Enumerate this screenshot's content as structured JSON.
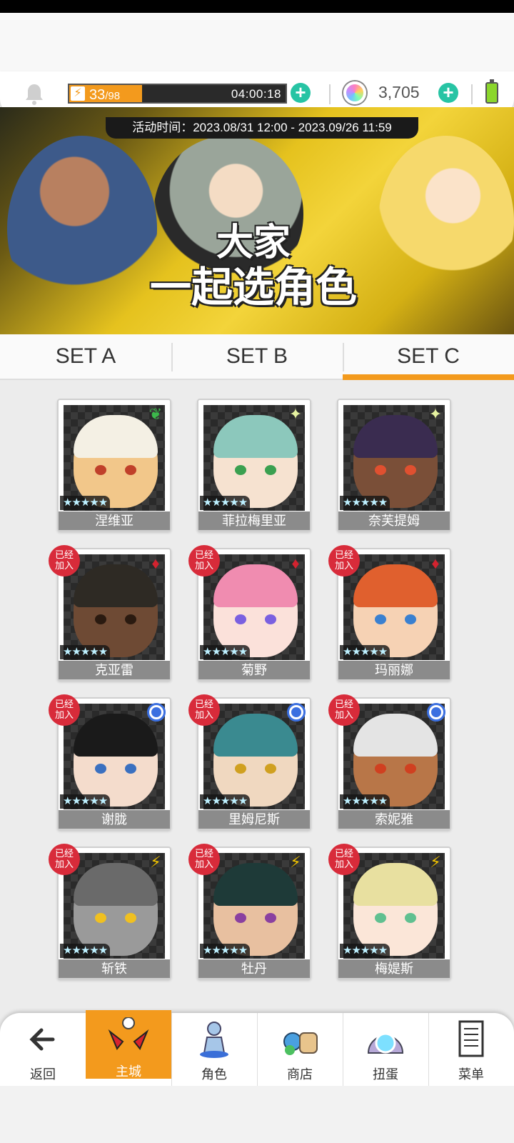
{
  "top_bar": {
    "energy_current": "33",
    "energy_max": "/98",
    "energy_fraction": 0.337,
    "energy_timer": "04:00:18",
    "gems": "3,705"
  },
  "banner": {
    "event_time": "活动时间：2023.08/31 12:00 - 2023.09/26 11:59",
    "title_line1": "大家",
    "title_line2": "一起选角色"
  },
  "tabs": [
    {
      "label": "SET A",
      "active": false
    },
    {
      "label": "SET B",
      "active": false
    },
    {
      "label": "SET C",
      "active": true
    }
  ],
  "joined_label_1": "已经",
  "joined_label_2": "加入",
  "characters": [
    {
      "name": "涅维亚",
      "element": "leaf-icon",
      "joined": false,
      "stars": 5
    },
    {
      "name": "菲拉梅里亚",
      "element": "sparkle-icon",
      "joined": false,
      "stars": 5
    },
    {
      "name": "奈芙提姆",
      "element": "sparkle-icon",
      "joined": false,
      "stars": 5
    },
    {
      "name": "克亚雷",
      "element": "diamond-icon",
      "joined": true,
      "stars": 5
    },
    {
      "name": "菊野",
      "element": "diamond-icon",
      "joined": true,
      "stars": 5
    },
    {
      "name": "玛丽娜",
      "element": "diamond-icon",
      "joined": true,
      "stars": 5
    },
    {
      "name": "谢胧",
      "element": "water-orb-icon",
      "joined": true,
      "stars": 5
    },
    {
      "name": "里姆尼斯",
      "element": "water-orb-icon",
      "joined": true,
      "stars": 5
    },
    {
      "name": "索妮雅",
      "element": "water-orb-icon",
      "joined": true,
      "stars": 5
    },
    {
      "name": "斩铁",
      "element": "lightning-icon",
      "joined": true,
      "stars": 5
    },
    {
      "name": "牡丹",
      "element": "lightning-icon",
      "joined": true,
      "stars": 5
    },
    {
      "name": "梅媞斯",
      "element": "lightning-icon",
      "joined": true,
      "stars": 5
    }
  ],
  "bottom_nav": [
    {
      "label": "返回",
      "icon": "back-arrow-icon",
      "active": false
    },
    {
      "label": "主城",
      "icon": "castle-icon",
      "active": true
    },
    {
      "label": "角色",
      "icon": "character-icon",
      "active": false
    },
    {
      "label": "商店",
      "icon": "shop-icon",
      "active": false
    },
    {
      "label": "扭蛋",
      "icon": "gacha-icon",
      "active": false
    },
    {
      "label": "菜单",
      "icon": "menu-list-icon",
      "active": false
    }
  ]
}
